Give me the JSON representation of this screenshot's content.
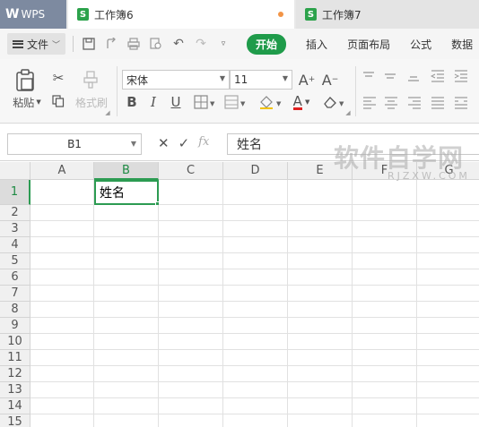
{
  "tabs": {
    "app": "WPS",
    "active_doc": "工作簿6",
    "other_doc": "工作簿7",
    "sheet_icon": "S"
  },
  "menubar": {
    "file": "文件",
    "items": [
      "开始",
      "插入",
      "页面布局",
      "公式",
      "数据"
    ]
  },
  "ribbon": {
    "paste": "粘贴",
    "format_painter": "格式刷",
    "font_name": "宋体",
    "font_size": "11",
    "bold": "B",
    "italic": "I",
    "underline": "U",
    "grow_font": "A",
    "shrink_font": "A",
    "font_color": "A"
  },
  "formula_bar": {
    "name_box": "B1",
    "fx": "fx",
    "value": "姓名"
  },
  "grid": {
    "columns": [
      "A",
      "B",
      "C",
      "D",
      "E",
      "F",
      "G"
    ],
    "rows": [
      "1",
      "2",
      "3",
      "4",
      "5",
      "6",
      "7",
      "8",
      "9",
      "10",
      "11",
      "12",
      "13",
      "14",
      "15"
    ],
    "active_cell": "B1",
    "cells": {
      "B1": "姓名"
    }
  },
  "watermark": {
    "title": "软件自学网",
    "url": "RJZXW.COM"
  },
  "colors": {
    "accent": "#1f9b4a",
    "selection": "#2c9b52",
    "modified_dot": "#f29446"
  }
}
